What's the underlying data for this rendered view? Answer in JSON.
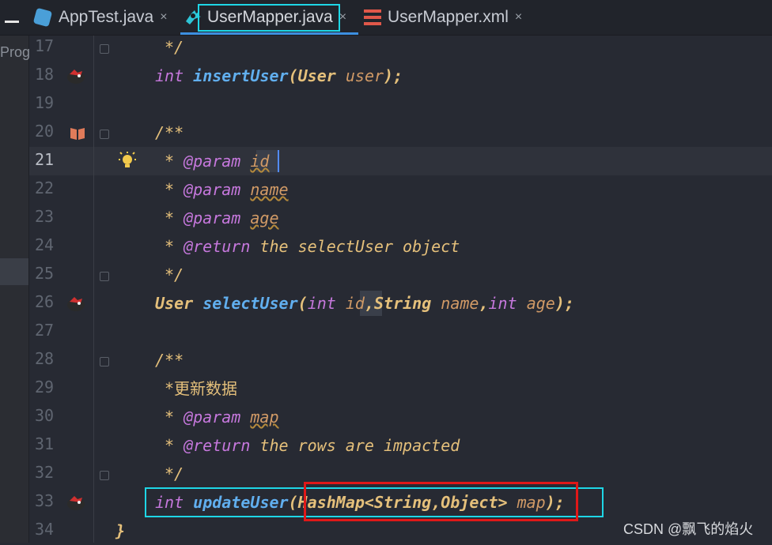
{
  "tabs": [
    {
      "label": "AppTest.java",
      "close": "×",
      "icon": "java-class-icon"
    },
    {
      "label": "UserMapper.java",
      "close": "×",
      "icon": "mybatis-bird-icon",
      "active": true
    },
    {
      "label": "UserMapper.xml",
      "close": "×",
      "icon": "xml-file-icon"
    }
  ],
  "left_panel": {
    "label": "Prog"
  },
  "editor": {
    "current_line": 21,
    "lines": [
      {
        "num": "17"
      },
      {
        "num": "18"
      },
      {
        "num": "19"
      },
      {
        "num": "20"
      },
      {
        "num": "21"
      },
      {
        "num": "22"
      },
      {
        "num": "23"
      },
      {
        "num": "24"
      },
      {
        "num": "25"
      },
      {
        "num": "26"
      },
      {
        "num": "27"
      },
      {
        "num": "28"
      },
      {
        "num": "29"
      },
      {
        "num": "30"
      },
      {
        "num": "31"
      },
      {
        "num": "32"
      },
      {
        "num": "33"
      },
      {
        "num": "34"
      }
    ],
    "code": {
      "l17": "*/",
      "l18_kw": "int",
      "l18_fn": "insertUser",
      "l18_p1": "(",
      "l18_ty": "User",
      "l18_pm": "user",
      "l18_p2": ");",
      "l20": "/**",
      "l21_star": "*",
      "l21_tag": "@param",
      "l21_name": "id",
      "l22_star": "*",
      "l22_tag": "@param",
      "l22_name": "name",
      "l23_star": "*",
      "l23_tag": "@param",
      "l23_name": "age",
      "l24_star": "*",
      "l24_tag": "@return",
      "l24_text": "the selectUser object",
      "l25": "*/",
      "l26_ty": "User",
      "l26_fn": "selectUser",
      "l26_p1": "(",
      "l26_kw1": "int",
      "l26_pm1": "id",
      "l26_c1": ",",
      "l26_ty2": "String",
      "l26_pm2": "name",
      "l26_c2": ",",
      "l26_kw2": "int",
      "l26_pm3": "age",
      "l26_p2": ");",
      "l28": "/**",
      "l29": "*更新数据",
      "l30_star": "*",
      "l30_tag": "@param",
      "l30_name": "map",
      "l31_star": "*",
      "l31_tag": "@return",
      "l31_text": "the rows are impacted",
      "l32": "*/",
      "l33_kw": "int",
      "l33_fn": "updateUser",
      "l33_p1": "(",
      "l33_ty": "HashMap<String,Object>",
      "l33_pm": "map",
      "l33_p2": ");",
      "l34": "}"
    }
  },
  "watermark": "CSDN @飘飞的焰火",
  "colors": {
    "background": "#272a33",
    "keyword": "#c678dd",
    "function": "#61afef",
    "type": "#e5c07b",
    "param": "#d19a66",
    "highlight_cyan": "#1ed6e6",
    "highlight_red": "#e01818"
  }
}
